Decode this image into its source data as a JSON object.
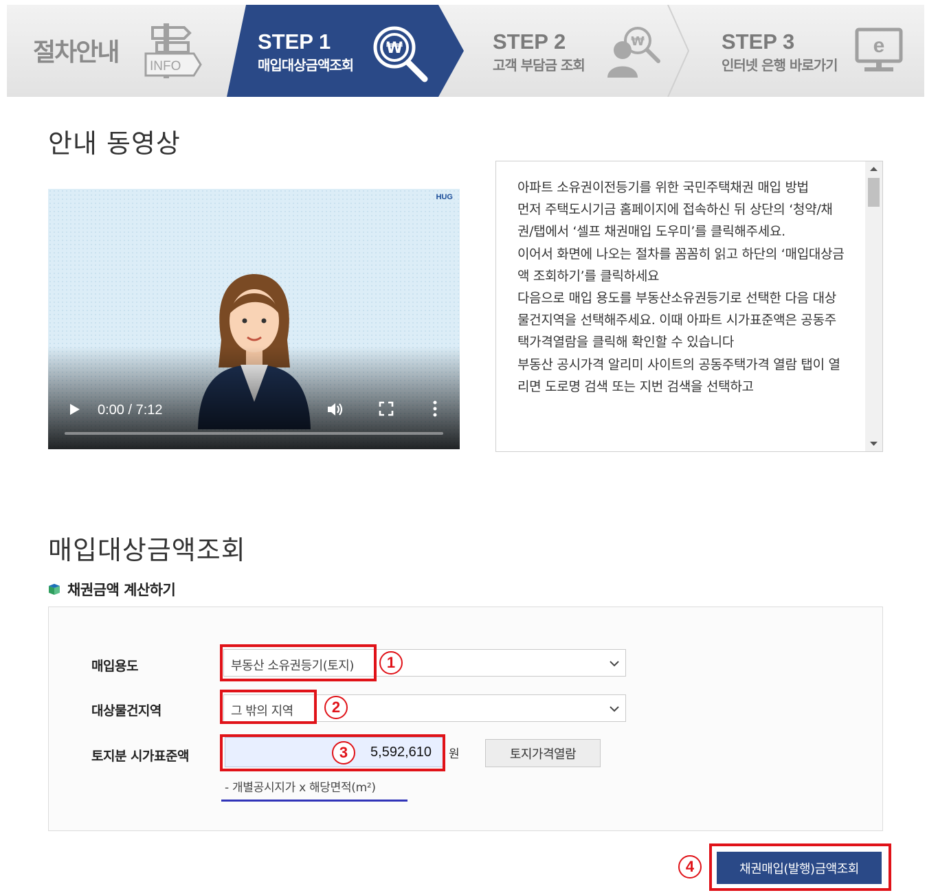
{
  "steps": {
    "intro": {
      "title": "절차안내",
      "badge": "INFO"
    },
    "step1": {
      "title": "STEP 1",
      "sub": "매입대상금액조회"
    },
    "step2": {
      "title": "STEP 2",
      "sub": "고객 부담금 조회"
    },
    "step3": {
      "title": "STEP 3",
      "sub": "인터넷 은행 바로가기"
    }
  },
  "video_section": {
    "title": "안내 동영상",
    "video": {
      "logo": "HUG",
      "time": "0:00 / 7:12"
    }
  },
  "transcript": {
    "paragraphs": [
      "아파트 소유권이전등기를 위한 국민주택채권 매입 방법",
      "먼저 주택도시기금 홈페이지에 접속하신 뒤 상단의 ‘청약/채권/탭에서 ‘셀프 채권매입 도우미’를 클릭해주세요.",
      "이어서 화면에 나오는 절차를 꼼꼼히 읽고 하단의 ‘매입대상금액 조회하기’를 클릭하세요",
      "다음으로 매입 용도를 부동산소유권등기로 선택한 다음 대상물건지역을 선택해주세요. 이때 아파트 시가표준액은 공동주택가격열람을 클릭해 확인할 수 있습니다",
      "부동산 공시가격 알리미 사이트의 공동주택가격 열람 탭이 열리면 도로명 검색 또는 지번 검색을 선택하고"
    ]
  },
  "calc_section": {
    "title": "매입대상금액조회",
    "subtitle": "채권금액 계산하기",
    "rows": {
      "purpose": {
        "label": "매입용도",
        "value": "부동산 소유권등기(토지)"
      },
      "region": {
        "label": "대상물건지역",
        "value": "그 밖의 지역"
      },
      "price": {
        "label": "토지분 시가표준액",
        "value": "5,592,610",
        "unit": "원",
        "button": "토지가격열람",
        "formula": "- 개별공시지가 x 해당면적(m²)"
      }
    },
    "markers": [
      "1",
      "2",
      "3",
      "4"
    ],
    "submit": "채권매입(발행)금액조회"
  },
  "colors": {
    "step_active": "#2a4987",
    "highlight": "#e01218",
    "underline": "#3034b8"
  }
}
